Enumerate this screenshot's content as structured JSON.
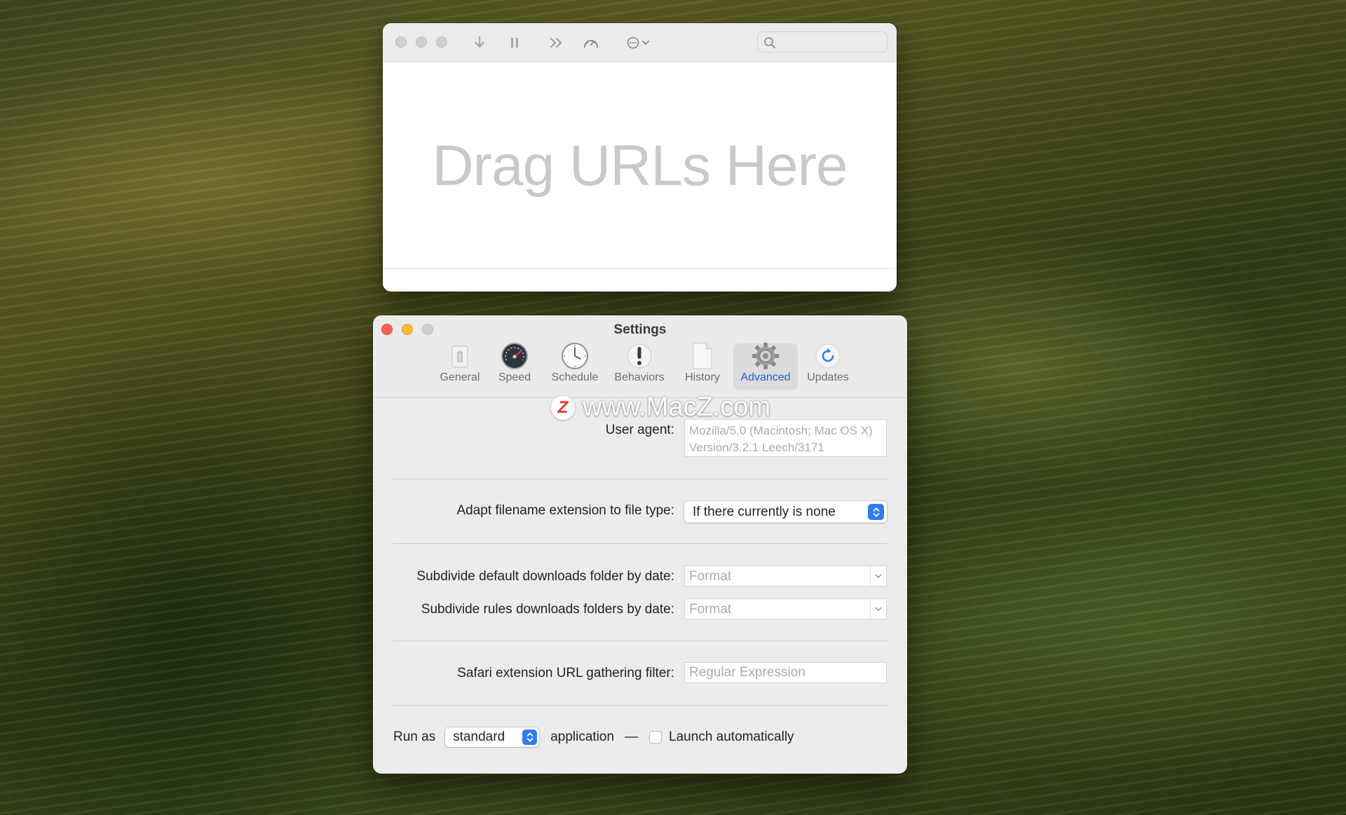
{
  "main_window": {
    "drop_placeholder": "Drag URLs Here",
    "toolbar_icons": [
      "download-icon",
      "pause-icon",
      "fast-forward-icon",
      "speedometer-icon",
      "more-options-icon",
      "chevron-down-icon",
      "search-icon"
    ]
  },
  "settings": {
    "title": "Settings",
    "tabs": [
      {
        "label": "General",
        "icon": "general-switch-icon"
      },
      {
        "label": "Speed",
        "icon": "speedometer-icon"
      },
      {
        "label": "Schedule",
        "icon": "clock-icon"
      },
      {
        "label": "Behaviors",
        "icon": "exclamation-icon"
      },
      {
        "label": "History",
        "icon": "document-icon"
      },
      {
        "label": "Advanced",
        "icon": "gear-icon",
        "active": true
      },
      {
        "label": "Updates",
        "icon": "refresh-icon"
      }
    ],
    "watermark": {
      "logo_letter": "Z",
      "text": "www.MacZ.com"
    },
    "user_agent": {
      "label": "User agent:",
      "value": "Mozilla/5.0 (Macintosh; Mac OS X) Version/3.2.1 Leech/3171"
    },
    "adapt_extension": {
      "label": "Adapt filename extension to file type:",
      "value": "If there currently is none"
    },
    "subdivide_default": {
      "label": "Subdivide default downloads folder by date:",
      "placeholder": "Format"
    },
    "subdivide_rules": {
      "label": "Subdivide rules downloads folders by date:",
      "placeholder": "Format"
    },
    "safari_filter": {
      "label": "Safari extension URL gathering filter:",
      "placeholder": "Regular Expression"
    },
    "run_as": {
      "prefix": "Run as",
      "value": "standard",
      "suffix": "application",
      "dash": "—",
      "launch_label": "Launch automatically",
      "launch_checked": false
    }
  },
  "colors": {
    "accent": "#2f7cf6",
    "active_tab_text": "#1f5fd6",
    "close": "#fe5f57",
    "minimize": "#febc2e"
  }
}
